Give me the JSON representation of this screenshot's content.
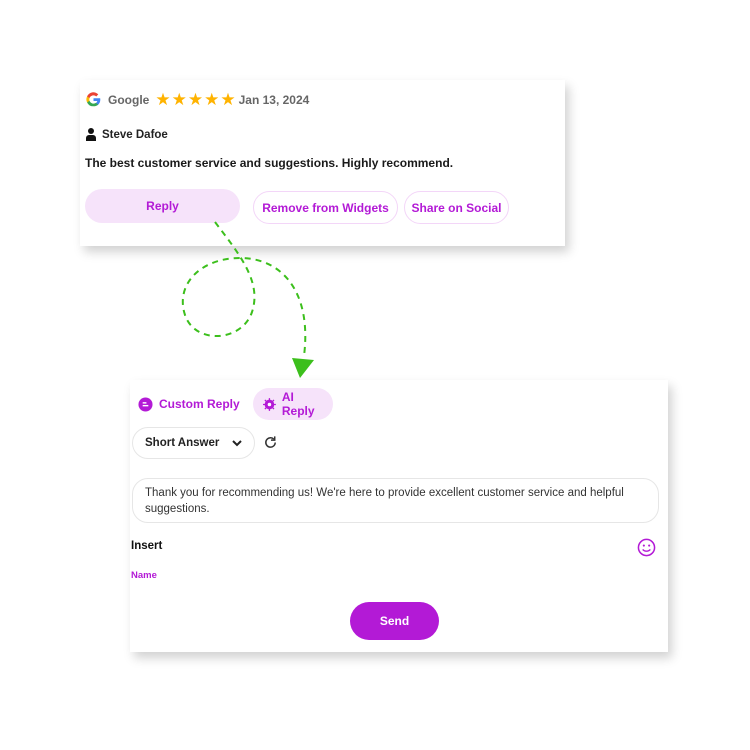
{
  "review": {
    "source": "Google",
    "rating": 5,
    "date": "Jan 13, 2024",
    "author": "Steve Dafoe",
    "text": "The best customer service and suggestions. Highly recommend.",
    "buttons": {
      "reply": "Reply",
      "remove": "Remove from Widgets",
      "share": "Share on Social"
    }
  },
  "reply_panel": {
    "tabs": [
      {
        "label": "Custom Reply",
        "active": false
      },
      {
        "label": "AI Reply",
        "active": true
      }
    ],
    "length_select": "Short Answer",
    "reply_text": "Thank you for recommending us! We're here to provide excellent customer service and helpful suggestions.",
    "insert_label": "Insert",
    "insert_name": "Name",
    "send": "Send"
  },
  "colors": {
    "accent": "#b31ad6",
    "accent_light": "#f6e3fa",
    "arrow": "#3cbf1c",
    "star": "#ffb300"
  }
}
